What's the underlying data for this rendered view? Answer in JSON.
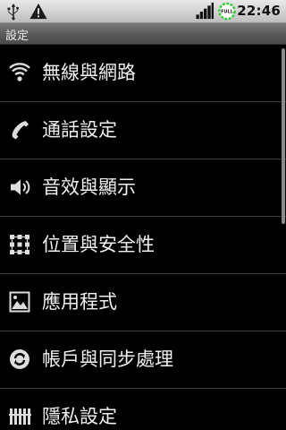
{
  "status_bar": {
    "time": "22:46",
    "icons": [
      "usb-icon",
      "warning-icon",
      "signal-icon",
      "battery-full-icon"
    ],
    "battery_label": "FULL"
  },
  "title_bar": {
    "title": "設定"
  },
  "settings_list": {
    "items": [
      {
        "label": "無線與網路",
        "icon": "wifi-icon"
      },
      {
        "label": "通話設定",
        "icon": "phone-icon"
      },
      {
        "label": "音效與顯示",
        "icon": "speaker-icon"
      },
      {
        "label": "位置與安全性",
        "icon": "location-grid-icon"
      },
      {
        "label": "應用程式",
        "icon": "applications-icon"
      },
      {
        "label": "帳戶與同步處理",
        "icon": "sync-icon"
      },
      {
        "label": "隱私設定",
        "icon": "privacy-icon"
      }
    ]
  },
  "colors": {
    "background": "#000000",
    "text": "#f0f0f0",
    "status_bar": "#d6d6d6",
    "title_bar": "#5a5a5a",
    "battery_ring": "#2ecc2e"
  }
}
